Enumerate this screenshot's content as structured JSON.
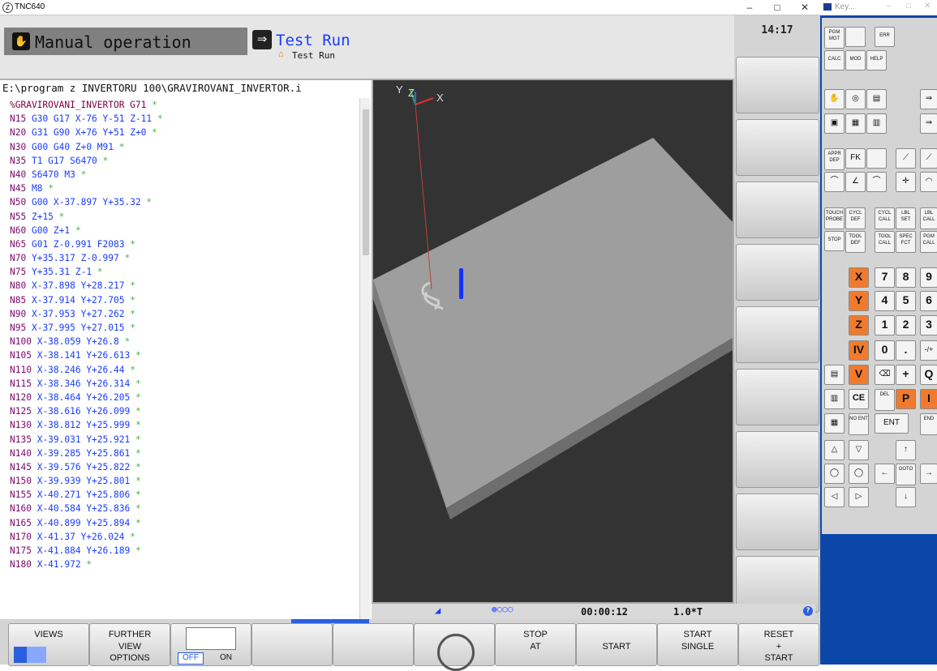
{
  "tnc_window": {
    "title": "TNC640"
  },
  "keyboard_window": {
    "title": "Key..."
  },
  "header": {
    "mode_primary": "Manual operation",
    "mode_secondary": "Test Run",
    "mode_secondary_sub": "Test Run",
    "clock": "14:17"
  },
  "program": {
    "path": "E:\\program z INVERTORU 100\\GRAVIROVANI_INVERTOR.i",
    "lines": [
      {
        "n": "%GRAVIROVANI_INVERTOR G71",
        "rest": ""
      },
      {
        "n": "N15",
        "rest": "G30 G17 X-76 Y-51 Z-11"
      },
      {
        "n": "N20",
        "rest": "G31 G90 X+76 Y+51 Z+0"
      },
      {
        "n": "N30",
        "rest": "G00 G40 Z+0 M91"
      },
      {
        "n": "N35",
        "rest": "T1 G17 S6470"
      },
      {
        "n": "N40",
        "rest": "S6470 M3"
      },
      {
        "n": "N45",
        "rest": "M8"
      },
      {
        "n": "N50",
        "rest": "G00 X-37.897 Y+35.32"
      },
      {
        "n": "N55",
        "rest": "Z+15"
      },
      {
        "n": "N60",
        "rest": "G00 Z+1"
      },
      {
        "n": "N65",
        "rest": "G01 Z-0.991 F2083"
      },
      {
        "n": "N70",
        "rest": "Y+35.317 Z-0.997"
      },
      {
        "n": "N75",
        "rest": "Y+35.31 Z-1"
      },
      {
        "n": "N80",
        "rest": "X-37.898 Y+28.217"
      },
      {
        "n": "N85",
        "rest": "X-37.914 Y+27.705"
      },
      {
        "n": "N90",
        "rest": "X-37.953 Y+27.262"
      },
      {
        "n": "N95",
        "rest": "X-37.995 Y+27.015"
      },
      {
        "n": "N100",
        "rest": "X-38.059 Y+26.8"
      },
      {
        "n": "N105",
        "rest": "X-38.141 Y+26.613"
      },
      {
        "n": "N110",
        "rest": "X-38.246 Y+26.44"
      },
      {
        "n": "N115",
        "rest": "X-38.346 Y+26.314"
      },
      {
        "n": "N120",
        "rest": "X-38.464 Y+26.205"
      },
      {
        "n": "N125",
        "rest": "X-38.616 Y+26.099"
      },
      {
        "n": "N130",
        "rest": "X-38.812 Y+25.999"
      },
      {
        "n": "N135",
        "rest": "X-39.031 Y+25.921"
      },
      {
        "n": "N140",
        "rest": "X-39.285 Y+25.861"
      },
      {
        "n": "N145",
        "rest": "X-39.576 Y+25.822"
      },
      {
        "n": "N150",
        "rest": "X-39.939 Y+25.801"
      },
      {
        "n": "N155",
        "rest": "X-40.271 Y+25.806"
      },
      {
        "n": "N160",
        "rest": "X-40.584 Y+25.836"
      },
      {
        "n": "N165",
        "rest": "X-40.899 Y+25.894"
      },
      {
        "n": "N170",
        "rest": "X-41.37 Y+26.024"
      },
      {
        "n": "N175",
        "rest": "X-41.884 Y+26.189"
      },
      {
        "n": "N180",
        "rest": "X-41.972"
      }
    ]
  },
  "view3d": {
    "axis_y": "Y",
    "axis_z": "Z",
    "axis_x": "X"
  },
  "status": {
    "time": "00:00:12",
    "factor": "1.0*T"
  },
  "softkeys": {
    "views": "VIEWS",
    "further_l1": "FURTHER",
    "further_l2": "VIEW",
    "further_l3": "OPTIONS",
    "toggle_off": "OFF",
    "toggle_on": "ON",
    "stop_l1": "STOP",
    "stop_l2": "AT",
    "start": "START",
    "start_single_l1": "START",
    "start_single_l2": "SINGLE",
    "reset_l1": "RESET",
    "reset_l2": "+",
    "reset_l3": "START"
  },
  "keys": {
    "pgm_mgt": "PGM MGT",
    "err": "ERR",
    "calc": "CALC",
    "mod": "MOD",
    "help": "HELP",
    "appr_dep": "APPR DEP",
    "fk": "FK",
    "touch_probe": "TOUCH PROBE",
    "cycl_def": "CYCL DEF",
    "cycl_call": "CYCL CALL",
    "lbl_set": "LBL SET",
    "lbl_call": "LBL CALL",
    "stop": "STOP",
    "tool_def": "TOOL DEF",
    "tool_call": "TOOL CALL",
    "spec_fct": "SPEC FCT",
    "pgm_call": "PGM CALL",
    "x": "X",
    "y": "Y",
    "z": "Z",
    "iv": "IV",
    "v": "V",
    "d7": "7",
    "d8": "8",
    "d9": "9",
    "d4": "4",
    "d5": "5",
    "d6": "6",
    "d1": "1",
    "d2": "2",
    "d3": "3",
    "d0": "0",
    "dot": ".",
    "sign": "-/+",
    "plus": "+",
    "q": "Q",
    "ce": "CE",
    "del": "DEL",
    "p": "P",
    "i": "I",
    "no_ent": "NO ENT",
    "ent": "ENT",
    "end": "END",
    "goto": "GOTO"
  }
}
